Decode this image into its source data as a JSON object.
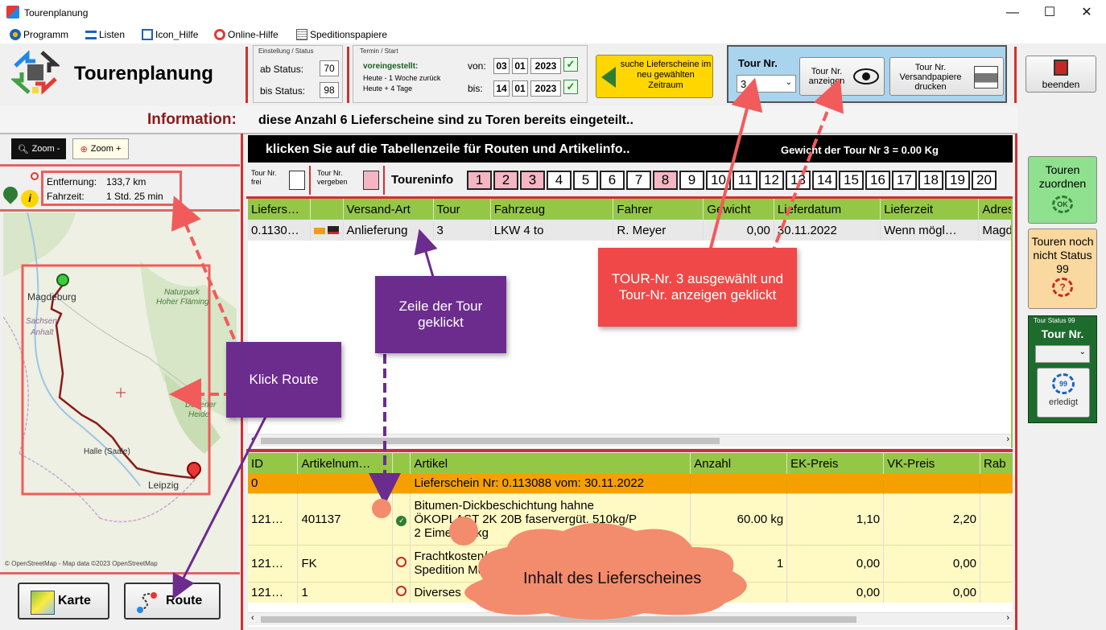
{
  "window": {
    "title": "Tourenplanung",
    "minimize": "—",
    "maximize": "☐",
    "close": "✕"
  },
  "menu": [
    "Programm",
    "Listen",
    "Icon_Hilfe",
    "Online-Hilfe",
    "Speditionspapiere"
  ],
  "header": {
    "app_title": "Tourenplanung",
    "status_group": {
      "label": "Einstellung / Status",
      "ab_label": "ab Status:",
      "ab_value": "70",
      "bis_label": "bis Status:",
      "bis_value": "98"
    },
    "termin_group": {
      "label": "Termin / Start",
      "preset": "voreingestellt:",
      "line1": "Heute - 1 Woche zurück",
      "line2": "Heute + 4 Tage",
      "von_label": "von:",
      "von": [
        "03",
        "01",
        "2023"
      ],
      "bis_label": "bis:",
      "bis": [
        "14",
        "01",
        "2023"
      ]
    },
    "search_button": "suche Lieferscheine im neu gewählten Zeitraum",
    "tour": {
      "label": "Tour Nr.",
      "value": "3",
      "show_button": "Tour Nr. anzeigen",
      "print_button": "Tour Nr. Versandpapiere drucken"
    },
    "exit_button": "beenden"
  },
  "info": {
    "label": "Information:",
    "text": "diese Anzahl 6 Lieferscheine sind zu Toren bereits eingeteilt.."
  },
  "zoom": {
    "minus": "Zoom -",
    "plus": "Zoom +"
  },
  "route_info": {
    "dist_label": "Entfernung:",
    "dist_value": "133,7 km",
    "time_label": "Fahrzeit:",
    "time_value": "1 Std. 25 min"
  },
  "map": {
    "places": [
      "Magdeburg",
      "Sachsen-",
      "Anhalt",
      "Naturpark",
      "Hoher Fläming",
      "Dübener",
      "Heide",
      "Halle (Saale)",
      "Leipzig"
    ],
    "attribution": "© OpenStreetMap - Map data ©2023 OpenStreetMap",
    "route_color": "#8b1a1a"
  },
  "bottom_buttons": {
    "karte": "Karte",
    "route": "Route"
  },
  "grid_header": {
    "hint": "klicken Sie auf die Tabellenzeile für Routen und Artikelinfo..",
    "weight": "Gewicht der Tour Nr  3  =  0.00  Kg"
  },
  "tourinfo": {
    "frei": "Tour Nr. frei",
    "vergeben": "Tour Nr. vergeben",
    "label": "Toureninfo",
    "numbers": [
      "1",
      "2",
      "3",
      "4",
      "5",
      "6",
      "7",
      "8",
      "9",
      "10",
      "11",
      "12",
      "13",
      "14",
      "15",
      "16",
      "17",
      "18",
      "19",
      "20"
    ],
    "pink": [
      1,
      2,
      3,
      8
    ]
  },
  "tours_table": {
    "columns": [
      "Liefers…",
      "",
      "Versand-Art",
      "Tour",
      "Fahrzeug",
      "Fahrer",
      "Gewicht",
      "Lieferdatum",
      "Lieferzeit",
      "Adress"
    ],
    "rows": [
      [
        "0.1130…",
        "",
        "Anlieferung",
        "3",
        "LKW 4 to",
        "R. Meyer",
        "0,00",
        "30.11.2022",
        "Wenn  mögl…",
        "Magde"
      ]
    ]
  },
  "articles_table": {
    "columns": [
      "ID",
      "Artikelnum…",
      "",
      "Artikel",
      "Anzahl",
      "EK-Preis",
      "VK-Preis",
      "Rab"
    ],
    "header_row": [
      "0",
      "",
      "",
      "Lieferschein Nr: 0.113088 vom: 30.11.2022",
      "",
      "",
      "",
      ""
    ],
    "rows": [
      {
        "id": "121…",
        "num": "401137",
        "icon": "ok",
        "artikel": [
          "Bitumen-Dickbeschichtung hahne",
          "ÖKOPLAST 2K 20B faservergüt. 510kg/P",
          "2 Eimer  30 kg"
        ],
        "anzahl": "60.00 kg",
        "ek": "1,10",
        "vk": "2,20"
      },
      {
        "id": "121…",
        "num": "FK",
        "icon": "no",
        "artikel": [
          "Frachtkosten/ M",
          "Spedition Mülle"
        ],
        "anzahl": "1",
        "ek": "0,00",
        "vk": "0,00"
      },
      {
        "id": "121…",
        "num": "1",
        "icon": "no",
        "artikel": [
          "Diverses"
        ],
        "anzahl": "",
        "ek": "0,00",
        "vk": "0,00"
      }
    ]
  },
  "callouts": {
    "route": "Klick Route",
    "row": "Zeile der Tour geklickt",
    "tour": "TOUR-Nr. 3 ausgewählt und Tour-Nr. anzeigen geklickt",
    "cloud": "Inhalt des Lieferscheines"
  },
  "right_panel": {
    "zuordnen": "Touren zuordnen",
    "nicht99": "Touren noch nicht Status 99",
    "group_label": "Tour Status 99",
    "tour_label": "Tour Nr.",
    "erledigt": "erledigt"
  },
  "colors": {
    "green_header": "#95c747",
    "purple": "#6b2c8e",
    "red_callout": "#f04848",
    "orange_row": "#f5a000",
    "yellow_row": "#fff9c4",
    "salmon": "#f38b6d"
  }
}
